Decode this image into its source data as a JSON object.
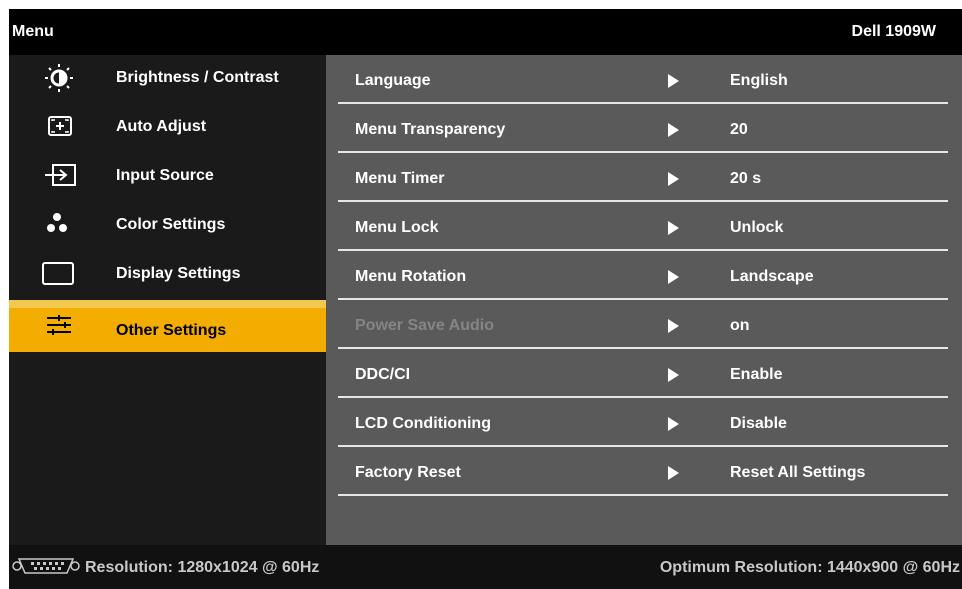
{
  "header": {
    "title": "Menu",
    "model": "Dell 1909W"
  },
  "sidebar": {
    "items": [
      {
        "label": "Brightness / Contrast",
        "icon": "brightness-icon"
      },
      {
        "label": "Auto Adjust",
        "icon": "auto-adjust-icon"
      },
      {
        "label": "Input Source",
        "icon": "input-source-icon"
      },
      {
        "label": "Color Settings",
        "icon": "color-settings-icon"
      },
      {
        "label": "Display Settings",
        "icon": "display-settings-icon"
      },
      {
        "label": "Other Settings",
        "icon": "other-settings-icon",
        "selected": true
      }
    ]
  },
  "settings": [
    {
      "name": "Language",
      "value": "English"
    },
    {
      "name": "Menu Transparency",
      "value": "20"
    },
    {
      "name": "Menu Timer",
      "value": "20 s"
    },
    {
      "name": "Menu Lock",
      "value": "Unlock"
    },
    {
      "name": "Menu Rotation",
      "value": "Landscape"
    },
    {
      "name": "Power Save Audio",
      "value": "on",
      "disabled": true
    },
    {
      "name": "DDC/CI",
      "value": "Enable"
    },
    {
      "name": "LCD Conditioning",
      "value": "Disable"
    },
    {
      "name": "Factory Reset",
      "value": "Reset All Settings"
    }
  ],
  "footer": {
    "resolution": "Resolution: 1280x1024 @ 60Hz",
    "optimum": "Optimum Resolution: 1440x900 @ 60Hz",
    "connector_icon": "vga-connector-icon"
  },
  "colors": {
    "highlight": "#f2ad00",
    "panel": "#5a5a5a",
    "sidebar": "#1a1a1a",
    "disabled_text": "#858585"
  }
}
